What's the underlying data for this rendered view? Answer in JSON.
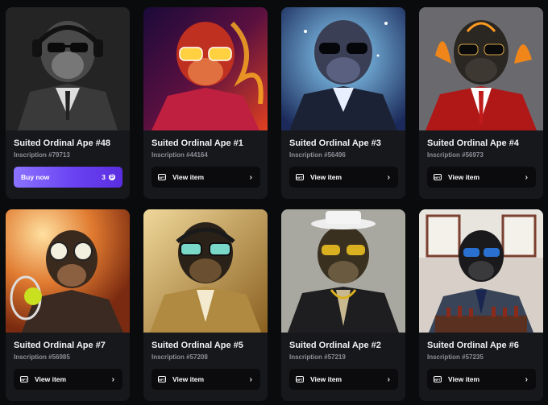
{
  "cards": [
    {
      "title": "Suited Ordinal Ape #48",
      "inscription": "Inscription #79713",
      "button": {
        "type": "buy",
        "label": "Buy now",
        "price": "3",
        "currency_icon": "bitcoin-icon"
      }
    },
    {
      "title": "Suited Ordinal Ape #1",
      "inscription": "Inscription #44164",
      "button": {
        "type": "view",
        "label": "View item",
        "badge": "NFT"
      }
    },
    {
      "title": "Suited Ordinal Ape #3",
      "inscription": "Inscription #56496",
      "button": {
        "type": "view",
        "label": "View item",
        "badge": "NFT"
      }
    },
    {
      "title": "Suited Ordinal Ape #4",
      "inscription": "Inscription #56973",
      "button": {
        "type": "view",
        "label": "View item",
        "badge": "NFT"
      }
    },
    {
      "title": "Suited Ordinal Ape #7",
      "inscription": "Inscription #56985",
      "button": {
        "type": "view",
        "label": "View item",
        "badge": "NFT"
      }
    },
    {
      "title": "Suited Ordinal Ape #5",
      "inscription": "Inscription #57208",
      "button": {
        "type": "view",
        "label": "View item",
        "badge": "NFT"
      }
    },
    {
      "title": "Suited Ordinal Ape #2",
      "inscription": "Inscription #57219",
      "button": {
        "type": "view",
        "label": "View item",
        "badge": "NFT"
      }
    },
    {
      "title": "Suited Ordinal Ape #6",
      "inscription": "Inscription #57235",
      "button": {
        "type": "view",
        "label": "View item",
        "badge": "NFT"
      }
    }
  ],
  "colors": {
    "background": "#0a0b0d",
    "card": "#17181c",
    "button": "#0b0b0d",
    "buy_gradient_start": "#8b73ff",
    "buy_gradient_end": "#5a2ee0",
    "muted_text": "#8d8f98"
  }
}
